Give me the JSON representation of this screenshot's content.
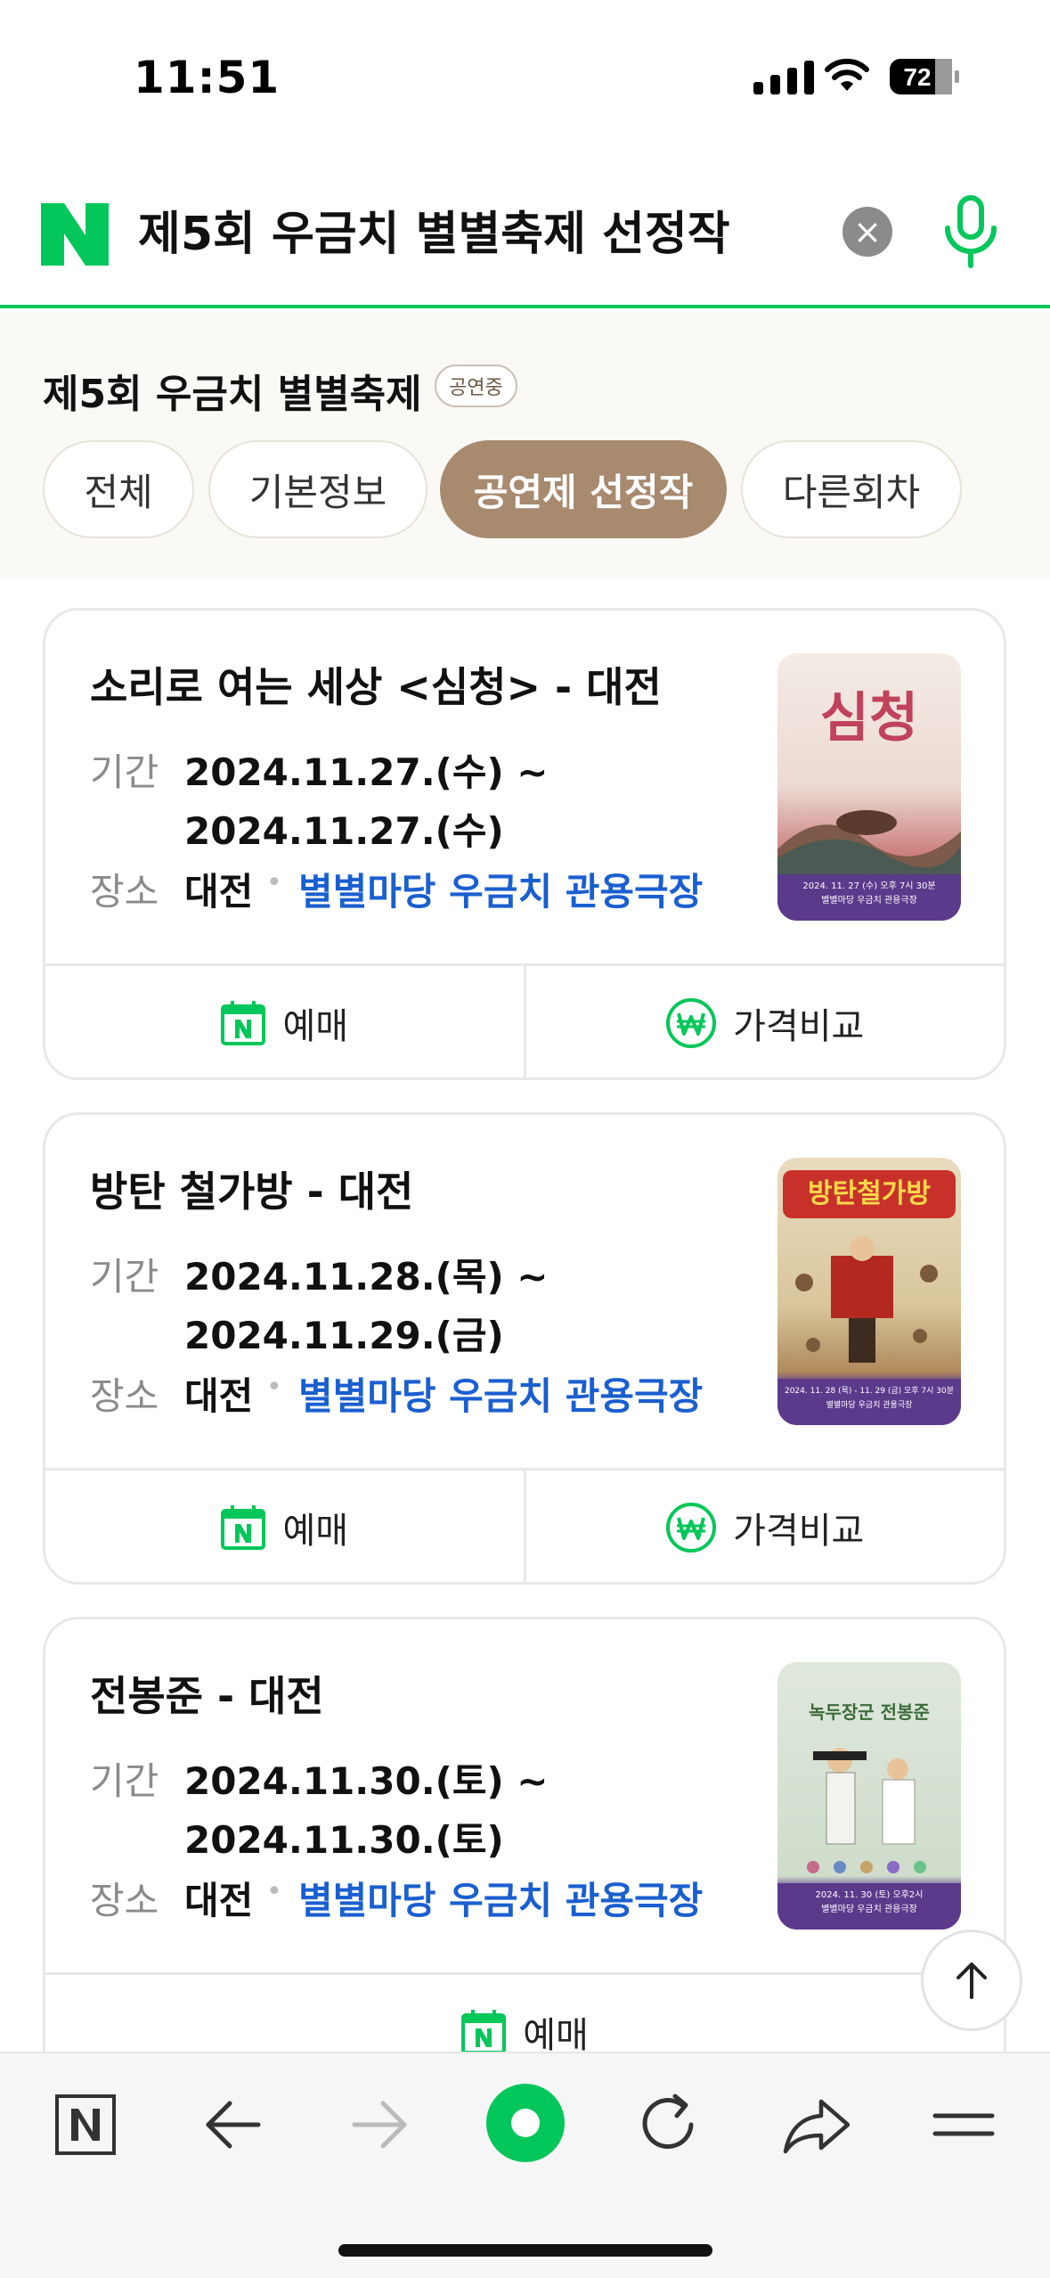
{
  "status_bar": {
    "time": "11:51",
    "battery": "72"
  },
  "search": {
    "query": "제5회 우금치 별별축제 선정작"
  },
  "festival": {
    "title": "제5회 우금치 별별축제",
    "badge": "공연중",
    "tabs": [
      {
        "label": "전체",
        "active": false
      },
      {
        "label": "기본정보",
        "active": false
      },
      {
        "label": "공연제 선정작",
        "active": true
      },
      {
        "label": "다른회차",
        "active": false
      }
    ]
  },
  "labels": {
    "period": "기간",
    "place": "장소",
    "reserve": "예매",
    "compare": "가격비교"
  },
  "shows": [
    {
      "title": "소리로 여는 세상 <심청> - 대전",
      "period_start": "2024.11.27.(수) ~",
      "period_end": "2024.11.27.(수)",
      "city": "대전",
      "venue": "별별마당 우금치 관용극장",
      "poster": {
        "big_text": "심청",
        "date_text": "2024. 11. 27 (수) 오후 7시 30분",
        "venue_text": "별별마당 우금치 관용극장"
      }
    },
    {
      "title": "방탄 철가방 - 대전",
      "period_start": "2024.11.28.(목) ~",
      "period_end": "2024.11.29.(금)",
      "city": "대전",
      "venue": "별별마당 우금치 관용극장",
      "poster": {
        "big_text": "방탄철가방",
        "date_text": "2024. 11. 28 (목) - 11. 29 (금) 오후 7시 30분",
        "venue_text": "별별마당 우금치 관용극장"
      }
    },
    {
      "title": "전봉준 - 대전",
      "period_start": "2024.11.30.(토) ~",
      "period_end": "2024.11.30.(토)",
      "city": "대전",
      "venue": "별별마당 우금치 관용극장",
      "poster": {
        "big_text": "녹두장군 전봉준",
        "date_text": "2024. 11. 30 (토) 오후2시",
        "venue_text": "별별마당 우금치 관용극장"
      }
    }
  ],
  "icons": [
    "n-logo-icon",
    "clear-icon",
    "mic-icon",
    "calendar-n-icon",
    "won-icon",
    "arrow-up-icon",
    "naver-home-icon",
    "back-icon",
    "forward-icon",
    "green-dot-icon",
    "reload-icon",
    "share-icon",
    "menu-icon"
  ],
  "colors": {
    "naver_green": "#03c75a",
    "tab_active": "#a88a6f",
    "link_blue": "#1a5fd0"
  }
}
